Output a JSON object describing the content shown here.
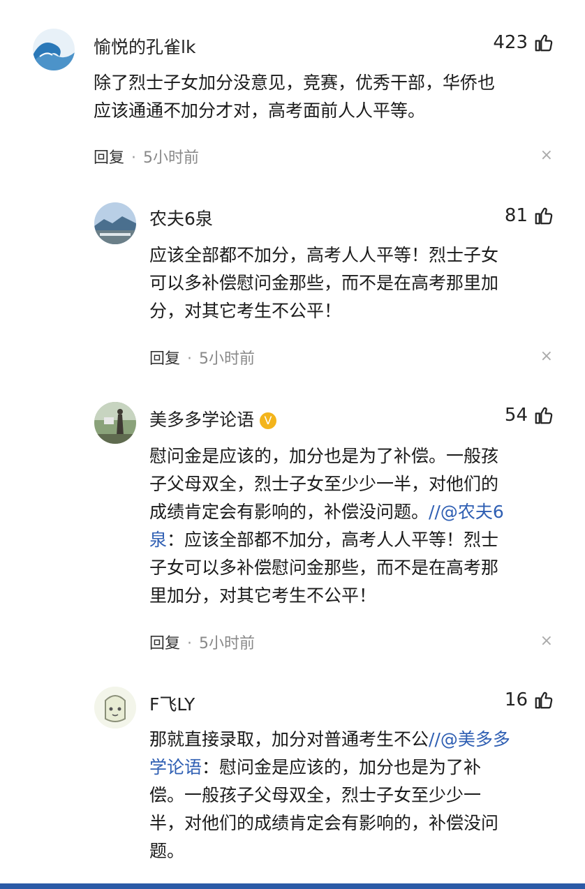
{
  "comments": [
    {
      "username": "愉悦的孔雀lk",
      "likes": "423",
      "lines": [
        "除了烈士子女加分没意见，竞赛，优秀干部，华侨也",
        "应该通通不加分才对，高考面前人人平等。"
      ],
      "reply_label": "回复",
      "time": "5小时前",
      "close": "×"
    },
    {
      "username": "农夫6泉",
      "likes": "81",
      "lines": [
        "应该全部都不加分，高考人人平等！烈士子女",
        "可以多补偿慰问金那些，而不是在高考那里加",
        "分，对其它考生不公平！"
      ],
      "reply_label": "回复",
      "time": "5小时前",
      "close": "×"
    },
    {
      "username": "美多多学论语",
      "verified": "V",
      "likes": "54",
      "lines": [
        "慰问金是应该的，加分也是为了补偿。一般孩",
        "子父母双全，烈士子女至少少一半，对他们的"
      ],
      "line3_text": "成绩肯定会有影响的，补偿没问题。",
      "line3_mention": "//@农夫6",
      "line4_mention": "泉",
      "line4_text": "：应该全部都不加分，高考人人平等！烈士",
      "lines_tail": [
        "子女可以多补偿慰问金那些，而不是在高考那",
        "里加分，对其它考生不公平！"
      ],
      "reply_label": "回复",
      "time": "5小时前",
      "close": "×"
    },
    {
      "username": "F飞LY",
      "likes": "16",
      "line1_text": "那就直接录取，加分对普通考生不公",
      "line1_mention": "//@美多多",
      "line2_mention": "学论语",
      "line2_text": "：慰问金是应该的，加分也是为了补",
      "lines_tail": [
        "偿。一般孩子父母双全，烈士子女至少少一",
        "半，对他们的成绩肯定会有影响的，补偿没问",
        "题。"
      ]
    }
  ],
  "icons": {
    "like": "thumbs-up-icon",
    "verified": "verified-badge-icon",
    "close": "close-icon"
  },
  "colors": {
    "mention": "#2f5fb3",
    "verified": "#f3b41b",
    "bottom_bar": "#2b5aa6"
  }
}
